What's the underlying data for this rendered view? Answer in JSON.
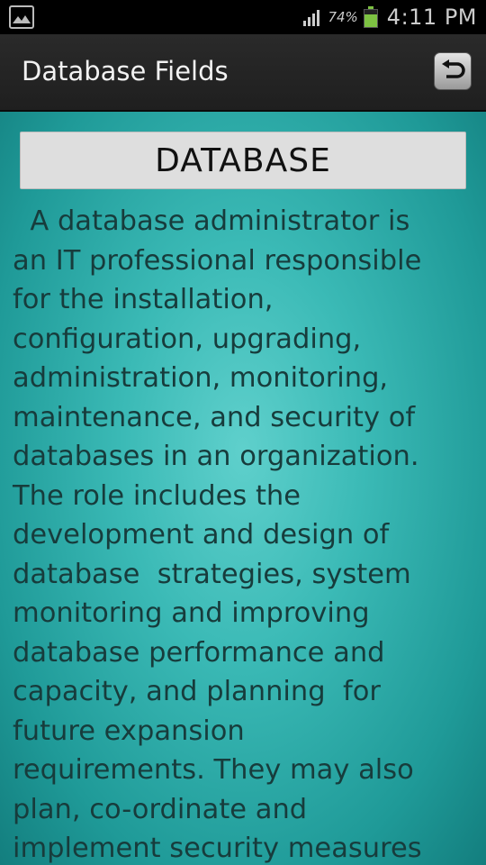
{
  "status_bar": {
    "battery_percent": "74%",
    "battery_level": 0.74,
    "time": "4:11 PM",
    "icons": [
      "gallery-notification-icon",
      "signal-icon",
      "battery-icon"
    ],
    "battery_color": "#7dc242"
  },
  "action_bar": {
    "title": "Database Fields",
    "back_icon": "return-arrow-icon"
  },
  "content": {
    "header": "DATABASE",
    "body_lines": [
      "  A database administrator is",
      "an IT professional responsible",
      "for the installation,",
      "configuration, upgrading,",
      "administration, monitoring,",
      "maintenance, and security of",
      "databases in an organization.",
      "The role includes the",
      "development and design of",
      "database  strategies, system",
      "monitoring and improving",
      "database performance and",
      "capacity, and planning  for",
      "future expansion",
      "requirements. They may also",
      "plan, co-ordinate and",
      "implement security measures"
    ],
    "background_color": "#3bbab6",
    "text_color": "#173c3c"
  }
}
